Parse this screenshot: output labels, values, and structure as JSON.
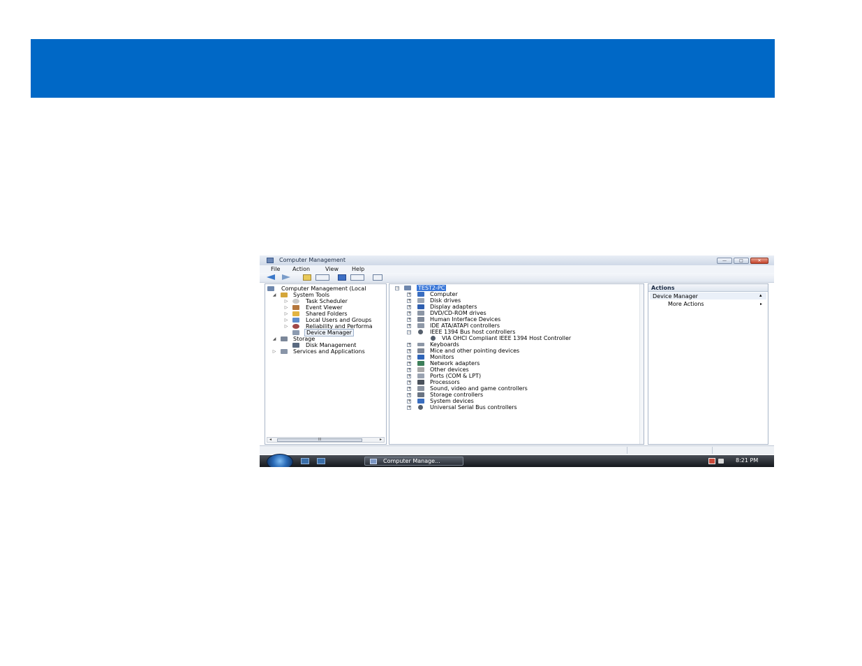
{
  "window": {
    "title": "Computer Management",
    "buttons": {
      "minimize": "—",
      "maximize": "□",
      "close": "✕"
    }
  },
  "menu": [
    "File",
    "Action",
    "View",
    "Help"
  ],
  "tree": {
    "root": "Computer Management (Local",
    "items": [
      {
        "label": "System Tools"
      },
      {
        "label": "Task Scheduler"
      },
      {
        "label": "Event Viewer"
      },
      {
        "label": "Shared Folders"
      },
      {
        "label": "Local Users and Groups"
      },
      {
        "label": "Reliability and Performa"
      },
      {
        "label": "Device Manager"
      },
      {
        "label": "Storage"
      },
      {
        "label": "Disk Management"
      },
      {
        "label": "Services and Applications"
      }
    ],
    "scroll_label": "III"
  },
  "devices": {
    "root": "TEST2-PC",
    "items": [
      "Computer",
      "Disk drives",
      "Display adapters",
      "DVD/CD-ROM drives",
      "Human Interface Devices",
      "IDE ATA/ATAPI controllers",
      "IEEE 1394 Bus host controllers",
      "VIA OHCI Compliant IEEE 1394 Host Controller",
      "Keyboards",
      "Mice and other pointing devices",
      "Monitors",
      "Network adapters",
      "Other devices",
      "Ports (COM & LPT)",
      "Processors",
      "Sound, video and game controllers",
      "Storage controllers",
      "System devices",
      "Universal Serial Bus controllers"
    ]
  },
  "actions": {
    "header": "Actions",
    "section": "Device Manager",
    "more": "More Actions"
  },
  "taskbar": {
    "task_label": "Computer Manage...",
    "clock": "8:21 PM"
  },
  "colors": {
    "banner": "#0068c6",
    "selection": "#3b78d8"
  }
}
